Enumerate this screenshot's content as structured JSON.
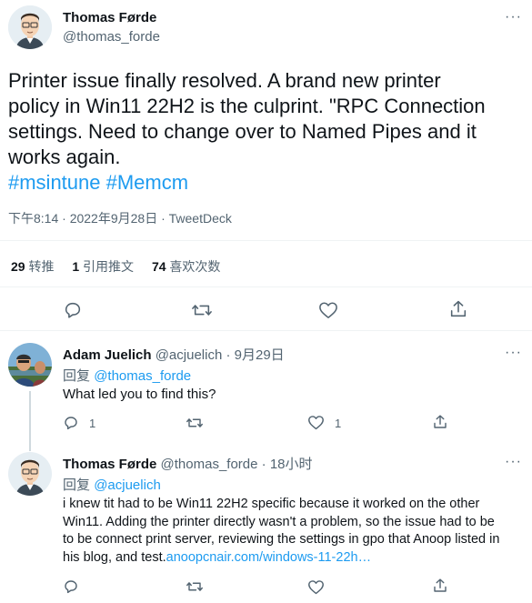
{
  "main_tweet": {
    "author_name": "Thomas Førde",
    "author_handle": "@thomas_forde",
    "text_lines": [
      "Printer issue finally resolved.  A brand new printer",
      "policy in Win11 22H2 is the culprint. \"RPC Connection",
      "settings. Need to change over to Named Pipes and it",
      "works again."
    ],
    "hashtags": "#msintune #Memcm",
    "timestamp": "下午8:14 · 2022年9月28日 · TweetDeck",
    "stats": {
      "retweets_count": "29",
      "retweets_label": "转推",
      "quotes_count": "1",
      "quotes_label": "引用推文",
      "likes_count": "74",
      "likes_label": "喜欢次数"
    }
  },
  "replies": [
    {
      "author_name": "Adam Juelich",
      "author_handle": "@acjuelich",
      "date": "· 9月29日",
      "reply_prefix": "回复",
      "reply_to": "@thomas_forde",
      "text_lines": [
        "What led you to find this?"
      ],
      "reply_count": "1",
      "like_count": "1"
    },
    {
      "author_name": "Thomas Førde",
      "author_handle": "@thomas_forde",
      "date": "· 18小时",
      "reply_prefix": "回复",
      "reply_to": "@acjuelich",
      "text_lines": [
        "i knew tit had to be Win11 22H2 specific because it worked on the other",
        "Win11. Adding the printer directly wasn't a problem, so the issue had to be",
        "to be connect print server, reviewing the settings in gpo that Anoop listed in"
      ],
      "text_last": "his blog, and test.",
      "link_text": "anoopcnair.com/windows-11-22h…",
      "reply_count": "",
      "like_count": ""
    }
  ],
  "more_label": "···",
  "icons": [
    "reply-icon",
    "retweet-icon",
    "like-icon",
    "share-icon",
    "more-icon"
  ],
  "colors": {
    "link": "#1d9bf0",
    "muted": "#536471",
    "divider": "#eff3f4",
    "text": "#0f1419"
  }
}
